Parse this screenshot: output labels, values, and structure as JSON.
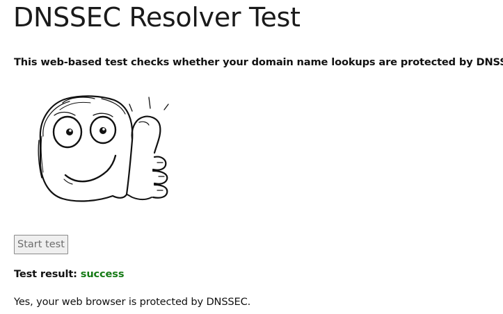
{
  "page": {
    "title": "DNSSEC Resolver Test",
    "intro": "This web-based test checks whether your domain name lookups are protected by DNSSEC."
  },
  "illustration": {
    "icon": "thumbs-up-face-icon"
  },
  "controls": {
    "start_button_label": "Start test"
  },
  "result": {
    "label": "Test result:",
    "value": "success",
    "value_color": "#157a15",
    "message": "Yes, your web browser is protected by DNSSEC."
  }
}
